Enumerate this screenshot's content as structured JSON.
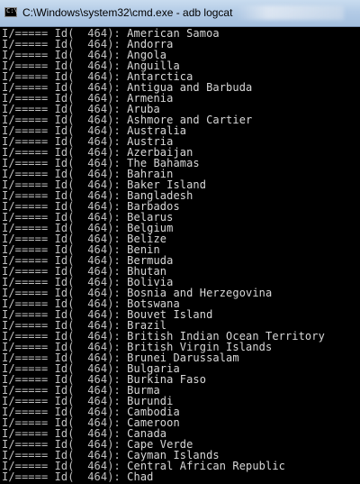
{
  "window": {
    "title": "C:\\Windows\\system32\\cmd.exe - adb  logcat"
  },
  "console": {
    "prefix": "I/===== Id(  464): ",
    "lines": [
      "American Samoa",
      "Andorra",
      "Angola",
      "Anguilla",
      "Antarctica",
      "Antigua and Barbuda",
      "Armenia",
      "Aruba",
      "Ashmore and Cartier",
      "Australia",
      "Austria",
      "Azerbaijan",
      "The Bahamas",
      "Bahrain",
      "Baker Island",
      "Bangladesh",
      "Barbados",
      "Belarus",
      "Belgium",
      "Belize",
      "Benin",
      "Bermuda",
      "Bhutan",
      "Bolivia",
      "Bosnia and Herzegovina",
      "Botswana",
      "Bouvet Island",
      "Brazil",
      "British Indian Ocean Territory",
      "British Virgin Islands",
      "Brunei Darussalam",
      "Bulgaria",
      "Burkina Faso",
      "Burma",
      "Burundi",
      "Cambodia",
      "Cameroon",
      "Canada",
      "Cape Verde",
      "Cayman Islands",
      "Central African Republic",
      "Chad"
    ]
  }
}
